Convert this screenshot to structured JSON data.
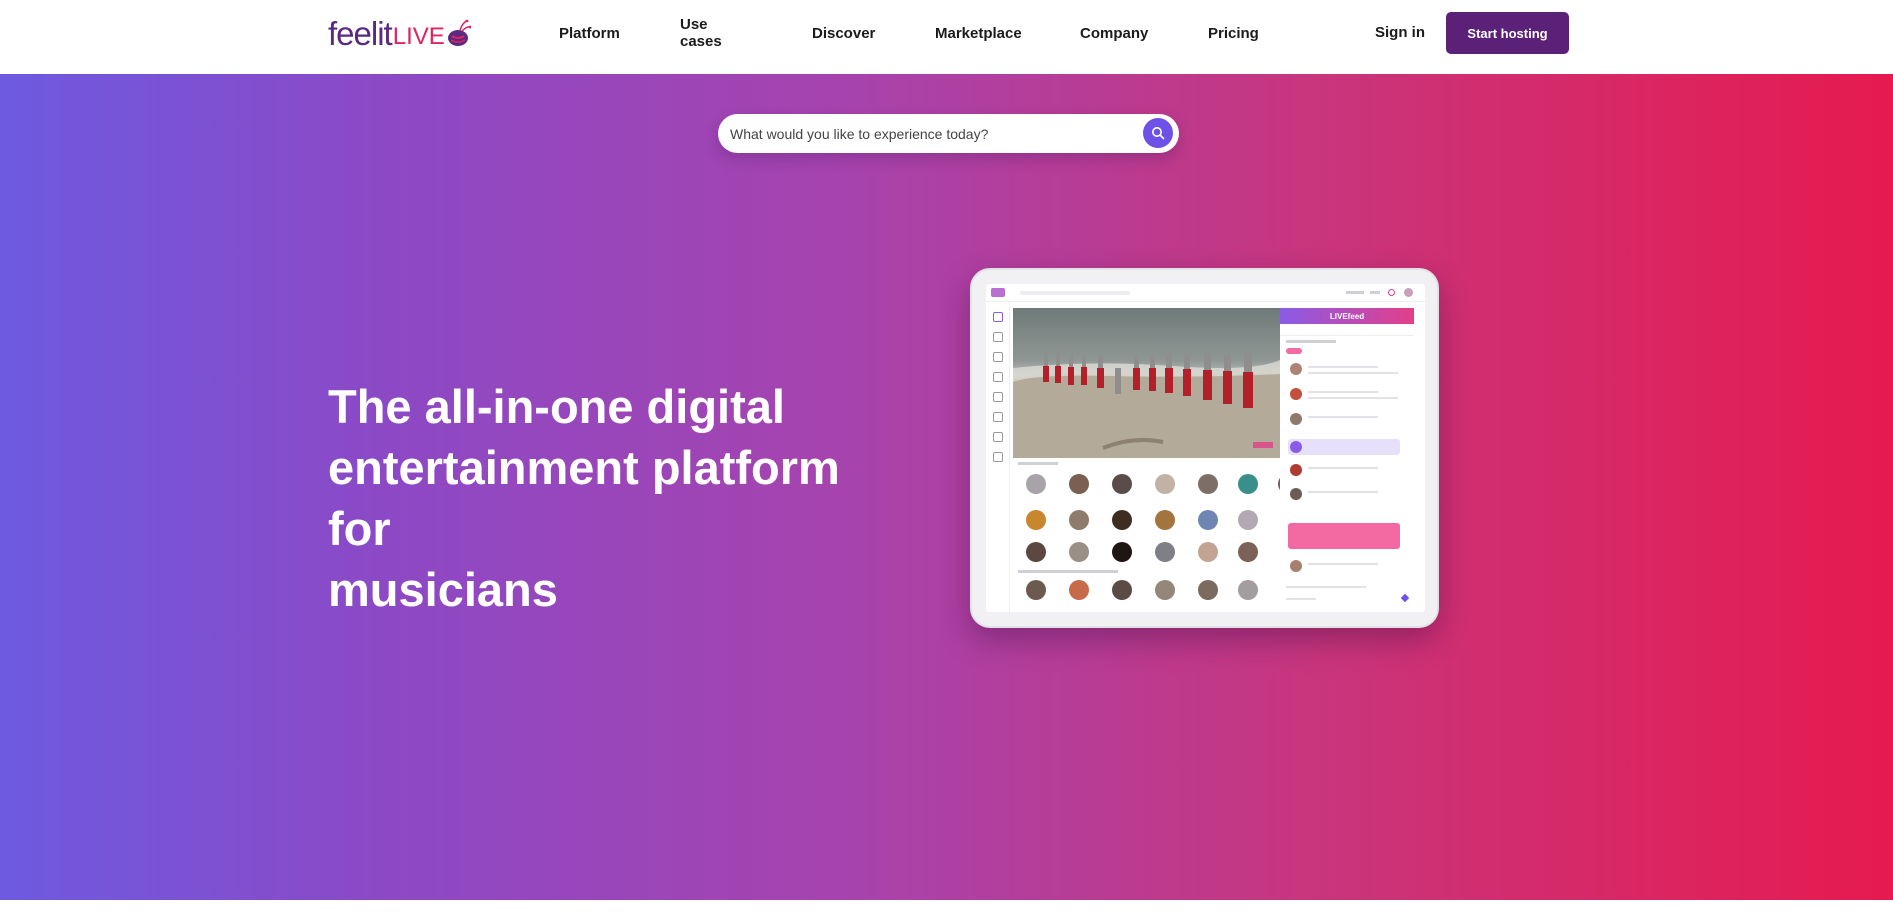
{
  "logo": {
    "brand_main": "feelit",
    "brand_live": "LIVE",
    "mark_icon": "bee-logo-icon"
  },
  "nav": {
    "links": [
      "Platform",
      "Use cases",
      "Discover",
      "Marketplace",
      "Company",
      "Pricing"
    ],
    "sign_in": "Sign in",
    "start_hosting": "Start hosting"
  },
  "search": {
    "placeholder": "What would you like to experience today?",
    "icon": "search-icon"
  },
  "hero": {
    "headline_lines": [
      "The all-in-one digital",
      "entertainment platform",
      "for",
      "musicians"
    ]
  },
  "preview": {
    "feed_title": "LIVEfeed"
  },
  "colors": {
    "brand_purple": "#5b2178",
    "brand_pink": "#e0245e",
    "gradient_start": "#6d5ae0",
    "gradient_end": "#e61a4f",
    "search_button": "#6e52e8"
  }
}
